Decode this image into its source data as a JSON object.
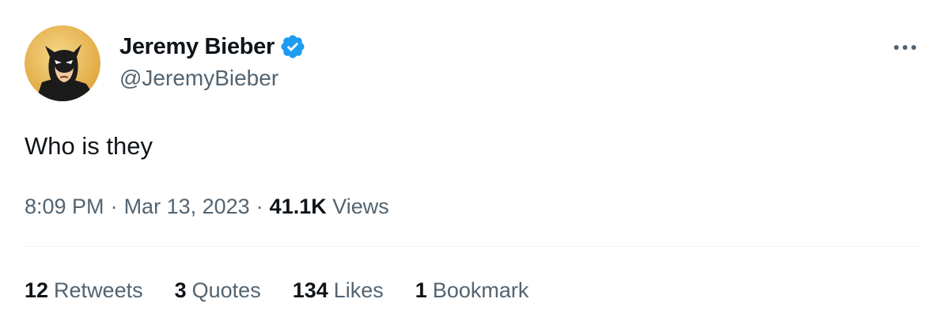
{
  "author": {
    "display_name": "Jeremy Bieber",
    "handle": "@JeremyBieber",
    "verified": true,
    "avatar_icon": "batman-cartoon-avatar",
    "verified_icon": "verified-badge-icon",
    "verified_color": "#1d9bf0"
  },
  "menu": {
    "more_icon": "more-horizontal-icon"
  },
  "tweet": {
    "text": "Who is they",
    "time": "8:09 PM",
    "separator": "·",
    "date": "Mar 13, 2023",
    "views_count": "41.1K",
    "views_label": "Views"
  },
  "stats": [
    {
      "count": "12",
      "label": "Retweets"
    },
    {
      "count": "3",
      "label": "Quotes"
    },
    {
      "count": "134",
      "label": "Likes"
    },
    {
      "count": "1",
      "label": "Bookmark"
    }
  ],
  "colors": {
    "primary_text": "#0f1419",
    "secondary_text": "#536471",
    "divider": "#eff3f4",
    "avatar_background": "#e9b94f"
  }
}
